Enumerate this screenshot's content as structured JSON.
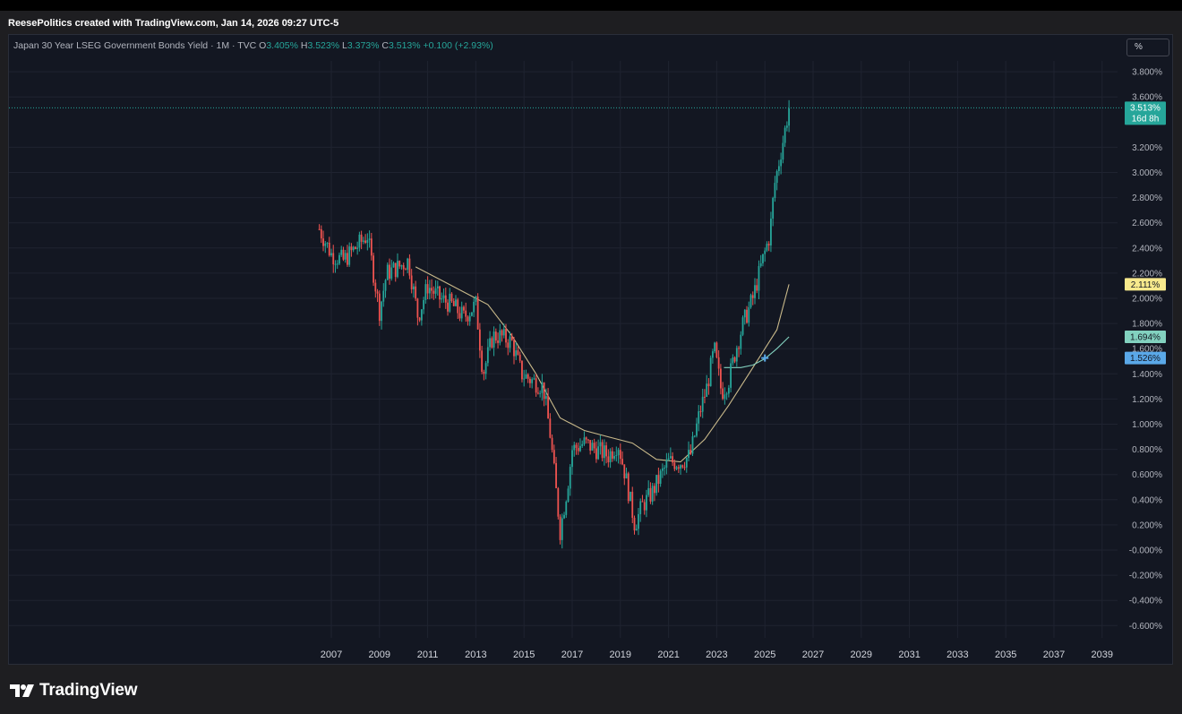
{
  "header": {
    "attribution": "ReesePolitics created with TradingView.com, Jan 14, 2026 09:27 UTC-5"
  },
  "legend": {
    "symbol": "Japan 30 Year LSEG Government Bonds Yield · 1M · TVC",
    "o_label": "O",
    "o_value": "3.405%",
    "h_label": "H",
    "h_value": "3.523%",
    "l_label": "L",
    "l_value": "3.373%",
    "c_label": "C",
    "c_value": "3.513%",
    "change": "+0.100 (+2.93%)"
  },
  "toolbar": {
    "unit_label": "%"
  },
  "brand": {
    "name": "TradingView"
  },
  "colors": {
    "up": "#26a69a",
    "down": "#ef5350",
    "ma_long": "#c9b98a",
    "background": "#131722",
    "grid": "#1f2330",
    "badge_last": "#26a69a",
    "badge_ma1": "#f7e98c",
    "badge_ma2": "#82d1bf",
    "badge_ma3": "#5aa8e8"
  },
  "chart_data": {
    "type": "candlestick",
    "title": "Japan 30 Year LSEG Government Bonds Yield",
    "interval": "1M",
    "unit": "%",
    "y_ticks": [
      "3.800%",
      "3.600%",
      "3.200%",
      "3.000%",
      "2.800%",
      "2.600%",
      "2.400%",
      "2.200%",
      "2.000%",
      "1.800%",
      "1.600%",
      "1.400%",
      "1.200%",
      "1.000%",
      "0.800%",
      "0.600%",
      "0.400%",
      "0.200%",
      "-0.000%",
      "-0.200%",
      "-0.400%",
      "-0.600%"
    ],
    "x_ticks": [
      "2007",
      "2009",
      "2011",
      "2013",
      "2015",
      "2017",
      "2019",
      "2021",
      "2023",
      "2025",
      "2027",
      "2029",
      "2031",
      "2033",
      "2035",
      "2037",
      "2039"
    ],
    "ylim": [
      -0.7,
      4.0
    ],
    "xlim": [
      2005.0,
      2040.0
    ],
    "last_price": {
      "value": 3.513,
      "label": "3.513%",
      "countdown": "16d 8h"
    },
    "badges": [
      {
        "value": 2.111,
        "label": "2.111%"
      },
      {
        "value": 1.694,
        "label": "1.694%"
      },
      {
        "value": 1.526,
        "label": "1.526%"
      }
    ],
    "series_approx_close": [
      [
        2006.5,
        2.55
      ],
      [
        2007.0,
        2.35
      ],
      [
        2007.5,
        2.3
      ],
      [
        2008.0,
        2.4
      ],
      [
        2008.5,
        2.5
      ],
      [
        2009.0,
        1.9
      ],
      [
        2009.3,
        2.2
      ],
      [
        2009.8,
        2.25
      ],
      [
        2010.2,
        2.3
      ],
      [
        2010.6,
        1.85
      ],
      [
        2011.0,
        2.1
      ],
      [
        2011.5,
        2.0
      ],
      [
        2012.0,
        1.95
      ],
      [
        2012.5,
        1.85
      ],
      [
        2013.0,
        1.95
      ],
      [
        2013.3,
        1.4
      ],
      [
        2013.7,
        1.7
      ],
      [
        2014.0,
        1.7
      ],
      [
        2014.5,
        1.65
      ],
      [
        2014.9,
        1.4
      ],
      [
        2015.3,
        1.35
      ],
      [
        2015.8,
        1.3
      ],
      [
        2016.1,
        0.9
      ],
      [
        2016.5,
        0.15
      ],
      [
        2016.8,
        0.5
      ],
      [
        2017.0,
        0.8
      ],
      [
        2017.5,
        0.85
      ],
      [
        2018.0,
        0.8
      ],
      [
        2018.5,
        0.75
      ],
      [
        2018.9,
        0.85
      ],
      [
        2019.2,
        0.6
      ],
      [
        2019.6,
        0.2
      ],
      [
        2019.9,
        0.35
      ],
      [
        2020.3,
        0.45
      ],
      [
        2020.7,
        0.6
      ],
      [
        2021.0,
        0.7
      ],
      [
        2021.5,
        0.7
      ],
      [
        2021.9,
        0.75
      ],
      [
        2022.3,
        1.1
      ],
      [
        2022.6,
        1.3
      ],
      [
        2022.9,
        1.6
      ],
      [
        2023.2,
        1.25
      ],
      [
        2023.5,
        1.35
      ],
      [
        2023.8,
        1.6
      ],
      [
        2024.1,
        1.8
      ],
      [
        2024.5,
        2.0
      ],
      [
        2024.9,
        2.3
      ],
      [
        2025.2,
        2.5
      ],
      [
        2025.4,
        2.9
      ],
      [
        2025.6,
        3.1
      ],
      [
        2025.8,
        3.3
      ],
      [
        2026.0,
        3.513
      ]
    ],
    "ma_long_approx": [
      [
        2010.5,
        2.25
      ],
      [
        2011.5,
        2.15
      ],
      [
        2012.5,
        2.05
      ],
      [
        2013.5,
        1.95
      ],
      [
        2014.5,
        1.7
      ],
      [
        2015.5,
        1.4
      ],
      [
        2016.5,
        1.05
      ],
      [
        2017.5,
        0.95
      ],
      [
        2018.5,
        0.9
      ],
      [
        2019.5,
        0.85
      ],
      [
        2020.5,
        0.72
      ],
      [
        2021.5,
        0.7
      ],
      [
        2022.5,
        0.88
      ],
      [
        2023.5,
        1.15
      ],
      [
        2024.5,
        1.45
      ],
      [
        2025.5,
        1.75
      ],
      [
        2026.0,
        2.111
      ]
    ],
    "ma_mid_approx": [
      [
        2023.3,
        1.45
      ],
      [
        2024.0,
        1.45
      ],
      [
        2024.5,
        1.47
      ],
      [
        2025.0,
        1.52
      ],
      [
        2025.5,
        1.6
      ],
      [
        2026.0,
        1.694
      ]
    ]
  }
}
